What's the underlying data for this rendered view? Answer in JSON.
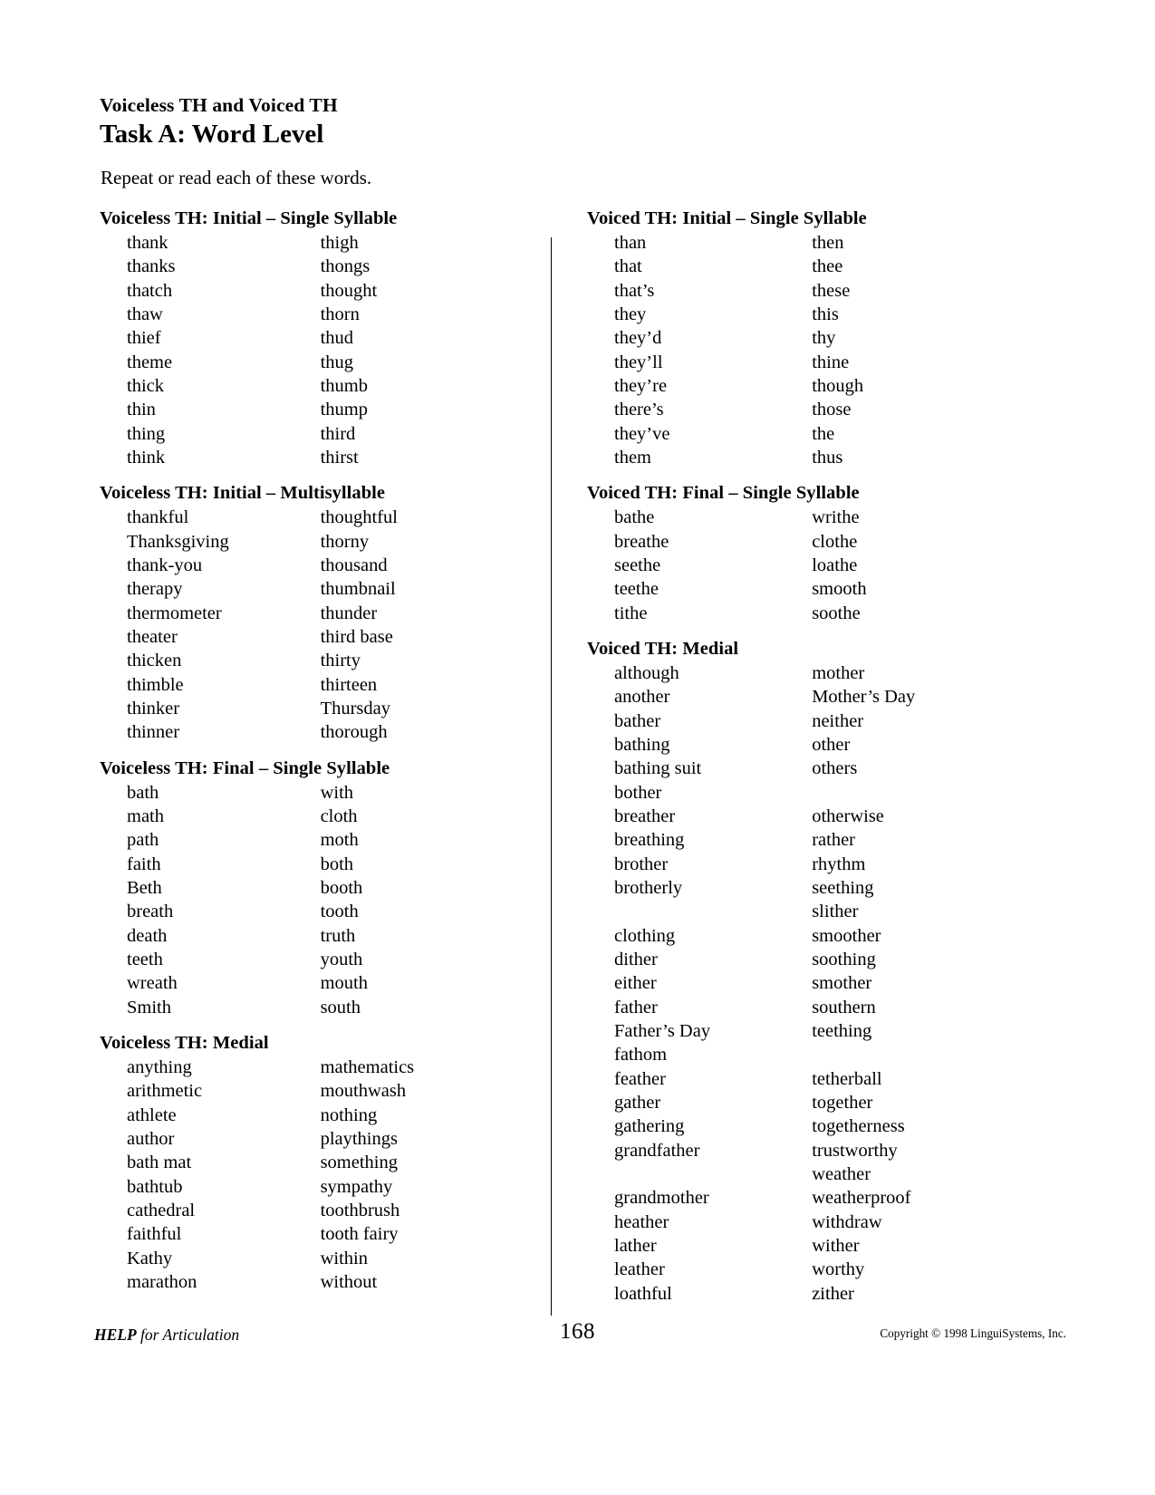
{
  "header": {
    "kicker": "Voiceless TH and Voiced TH",
    "task_title": "Task A:  Word Level",
    "instruction": "Repeat or read each of these words."
  },
  "left_column": {
    "sections": [
      {
        "heading": "Voiceless TH:  Initial – Single Syllable",
        "rows": [
          [
            "thank",
            "thigh"
          ],
          [
            "thanks",
            "thongs"
          ],
          [
            "thatch",
            "thought"
          ],
          [
            "thaw",
            "thorn"
          ],
          [
            "thief",
            "thud"
          ],
          [
            "theme",
            "thug"
          ],
          [
            "thick",
            "thumb"
          ],
          [
            "thin",
            "thump"
          ],
          [
            "thing",
            "third"
          ],
          [
            "think",
            "thirst"
          ]
        ]
      },
      {
        "heading": "Voiceless TH:  Initial – Multisyllable",
        "rows": [
          [
            "thankful",
            "thoughtful"
          ],
          [
            "Thanksgiving",
            "thorny"
          ],
          [
            "thank-you",
            "thousand"
          ],
          [
            "therapy",
            "thumbnail"
          ],
          [
            "thermometer",
            "thunder"
          ],
          [
            "theater",
            "third base"
          ],
          [
            "thicken",
            "thirty"
          ],
          [
            "thimble",
            "thirteen"
          ],
          [
            "thinker",
            "Thursday"
          ],
          [
            "thinner",
            "thorough"
          ]
        ]
      },
      {
        "heading": "Voiceless TH:  Final – Single Syllable",
        "rows": [
          [
            "bath",
            "with"
          ],
          [
            "math",
            "cloth"
          ],
          [
            "path",
            "moth"
          ],
          [
            "faith",
            "both"
          ],
          [
            "Beth",
            "booth"
          ],
          [
            "breath",
            "tooth"
          ],
          [
            "death",
            "truth"
          ],
          [
            "teeth",
            "youth"
          ],
          [
            "wreath",
            "mouth"
          ],
          [
            "Smith",
            "south"
          ]
        ]
      },
      {
        "heading": "Voiceless TH:  Medial",
        "rows": [
          [
            "anything",
            "mathematics"
          ],
          [
            "arithmetic",
            "mouthwash"
          ],
          [
            "athlete",
            "nothing"
          ],
          [
            "author",
            "playthings"
          ],
          [
            "bath mat",
            "something"
          ],
          [
            "bathtub",
            "sympathy"
          ],
          [
            "cathedral",
            "toothbrush"
          ],
          [
            "faithful",
            "tooth fairy"
          ],
          [
            "Kathy",
            "within"
          ],
          [
            "marathon",
            "without"
          ]
        ]
      }
    ]
  },
  "right_column": {
    "sections": [
      {
        "heading": "Voiced TH:  Initial – Single Syllable",
        "rows": [
          [
            "than",
            "then"
          ],
          [
            "that",
            "thee"
          ],
          [
            "that’s",
            "these"
          ],
          [
            "they",
            "this"
          ],
          [
            "they’d",
            "thy"
          ],
          [
            "they’ll",
            "thine"
          ],
          [
            "they’re",
            "though"
          ],
          [
            "there’s",
            "those"
          ],
          [
            "they’ve",
            "the"
          ],
          [
            "them",
            "thus"
          ]
        ]
      },
      {
        "heading": "Voiced TH:  Final – Single Syllable",
        "rows": [
          [
            "bathe",
            "writhe"
          ],
          [
            "breathe",
            "clothe"
          ],
          [
            "seethe",
            "loathe"
          ],
          [
            "teethe",
            "smooth"
          ],
          [
            "tithe",
            "soothe"
          ]
        ]
      },
      {
        "heading": "Voiced TH:  Medial",
        "rows": [
          [
            "although",
            "mother"
          ],
          [
            "another",
            "Mother’s Day"
          ],
          [
            "bather",
            "neither"
          ],
          [
            "bathing",
            "other"
          ],
          [
            "bathing suit",
            "others"
          ],
          [
            "bother",
            ""
          ],
          [
            "breather",
            "otherwise"
          ],
          [
            "breathing",
            "rather"
          ],
          [
            "brother",
            "rhythm"
          ],
          [
            "brotherly",
            "seething"
          ],
          [
            "",
            "slither"
          ],
          [
            "clothing",
            "smoother"
          ],
          [
            "dither",
            "soothing"
          ],
          [
            "either",
            "smother"
          ],
          [
            "father",
            "southern"
          ],
          [
            "Father’s Day",
            "teething"
          ],
          [
            "fathom",
            ""
          ],
          [
            "feather",
            "tetherball"
          ],
          [
            "gather",
            "together"
          ],
          [
            "gathering",
            "togetherness"
          ],
          [
            "grandfather",
            "trustworthy"
          ],
          [
            "",
            "weather"
          ],
          [
            "grandmother",
            "weatherproof"
          ],
          [
            "heather",
            "withdraw"
          ],
          [
            "lather",
            "wither"
          ],
          [
            "leather",
            "worthy"
          ],
          [
            "loathful",
            "zither"
          ]
        ]
      }
    ]
  },
  "footer": {
    "book_title_bold": "HELP",
    "book_title_rest": " for Articulation",
    "page_number": "168",
    "copyright": "Copyright © 1998 LinguiSystems, Inc."
  }
}
